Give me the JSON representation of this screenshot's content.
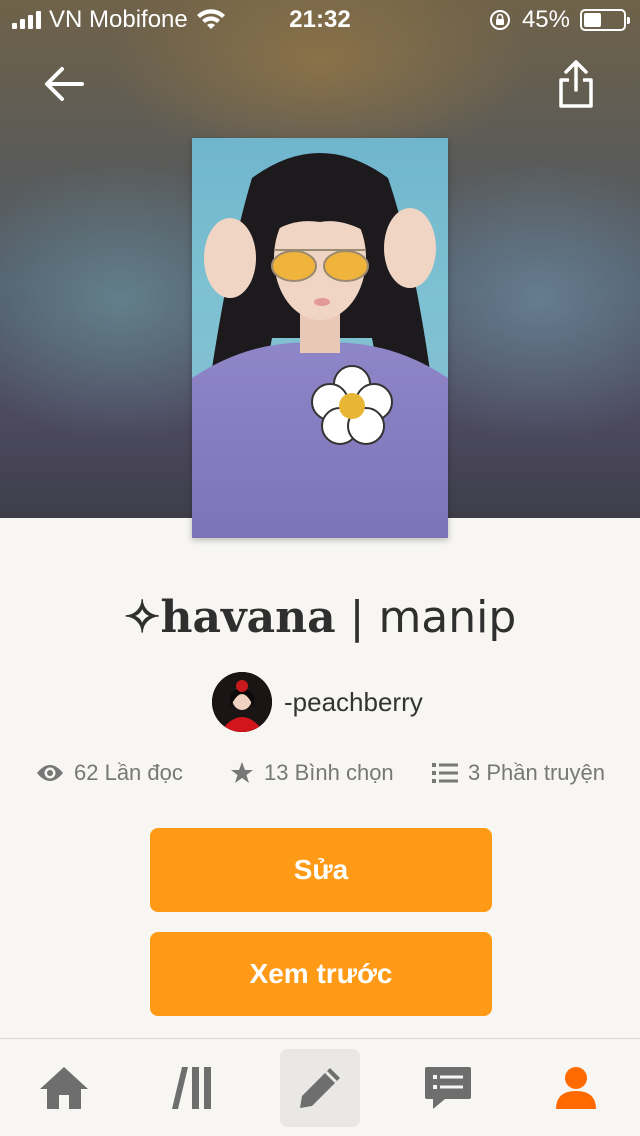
{
  "status_bar": {
    "carrier": "VN Mobifone",
    "time": "21:32",
    "battery": "45%",
    "battery_level": 0.45
  },
  "header": {
    "back_icon": "arrow-left-icon",
    "share_icon": "share-icon"
  },
  "story": {
    "title_bold": "✧havana",
    "title_separator": " | ",
    "title_rest": "manip",
    "author": "-peachberry"
  },
  "stats": {
    "reads": "62 Lần đọc",
    "votes": "13 Bình chọn",
    "parts": "3 Phần truyện"
  },
  "actions": {
    "edit_label": "Sửa",
    "preview_label": "Xem trước"
  },
  "tabbar": {
    "items": [
      "home-icon",
      "library-icon",
      "write-icon",
      "messages-icon",
      "profile-icon"
    ],
    "active_color": "#ff6a00",
    "inactive_color": "#6e6e6e"
  }
}
